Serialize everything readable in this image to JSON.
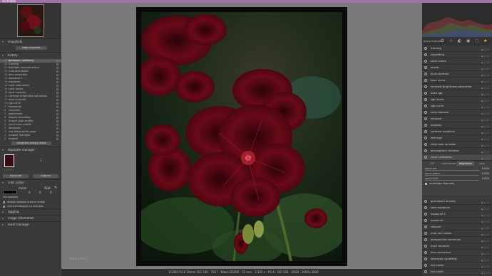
{
  "window": {
    "title": "darktable"
  },
  "left": {
    "snapshots": {
      "title": "snapshots",
      "button": "take snapshot"
    },
    "history": {
      "title": "history",
      "items": [
        {
          "n": "22",
          "label": "demosaic (uniform)"
        },
        {
          "n": "21",
          "label": "framing"
        },
        {
          "n": "20",
          "label": "highlight reconstruction"
        },
        {
          "n": "19",
          "label": "crop and rotate"
        },
        {
          "n": "18",
          "label": "lens correction"
        },
        {
          "n": "17",
          "label": "exposure 1"
        },
        {
          "n": "16",
          "label": "exposure"
        },
        {
          "n": "15",
          "label": "color calibration"
        },
        {
          "n": "14",
          "label": "color zones"
        },
        {
          "n": "13",
          "label": "local contrast"
        },
        {
          "n": "12",
          "label": "contrast brightness saturation"
        },
        {
          "n": "11",
          "label": "local contrast"
        },
        {
          "n": "10",
          "label": "rgb curve"
        },
        {
          "n": "9",
          "label": "toneequal"
        },
        {
          "n": "8",
          "label": "channels"
        },
        {
          "n": "7",
          "label": "watermark"
        },
        {
          "n": "6",
          "label": "display encoding"
        },
        {
          "n": "5",
          "label": "output color profile"
        },
        {
          "n": "4",
          "label": "input color profile"
        },
        {
          "n": "3",
          "label": "demosaic"
        },
        {
          "n": "2",
          "label": "raw black/white point"
        },
        {
          "n": "1",
          "label": "module manager"
        },
        {
          "n": "0",
          "label": "original"
        }
      ],
      "button": "compress history stack"
    },
    "duplicate": {
      "title": "duplicate manager",
      "count": "1",
      "btn_original": "duplicate",
      "btn_virgin": "original"
    },
    "colorpicker": {
      "title": "color picker",
      "mode_label": "mean",
      "model_label": "RGB",
      "values": [
        "0",
        "0",
        "0"
      ],
      "live": "live samples",
      "check1": "display samples area on image",
      "check2": "restrict histogram to selection"
    },
    "tagging": {
      "title": "tagging"
    },
    "image_info": {
      "title": "image information"
    },
    "mask_manager": {
      "title": "mask manager"
    }
  },
  "center": {
    "watermark_text": "with pixel!"
  },
  "statusbar": {
    "text": "1/1000 f/2.8 50mm ISO 100 · 7017 · Nikon D3200 · 55 mm · 1/125 s · f/5.6 · ISO 100 · sRGB · 2000×3000"
  },
  "right": {
    "tabs": [
      "group modules"
    ],
    "modules_top": [
      {
        "label": "framing"
      },
      {
        "label": "vignetting"
      },
      {
        "label": "color zones"
      },
      {
        "label": "velvia"
      },
      {
        "label": "local contrast"
      },
      {
        "label": "tone curve"
      },
      {
        "label": "contrast brightness saturation"
      },
      {
        "label": "base rgb"
      },
      {
        "label": "rgb levels"
      },
      {
        "label": "rgb curve"
      },
      {
        "label": "color balance"
      },
      {
        "label": "sharpen"
      },
      {
        "label": "lowpass"
      },
      {
        "label": "contrast equalizer"
      },
      {
        "label": "defringe"
      },
      {
        "label": "color look up table"
      },
      {
        "label": "atmospheric denoise"
      },
      {
        "label": "color calibration"
      }
    ],
    "cal_tabs": [
      "CAT",
      "colorfulness",
      "brightness",
      "gray"
    ],
    "sliders": [
      {
        "label": "input red",
        "value": "0.000"
      },
      {
        "label": "input green",
        "value": "0.000"
      },
      {
        "label": "input blue",
        "value": "0.000"
      }
    ],
    "normalize": "normalize channels",
    "modules_bottom": [
      {
        "label": "graduated density"
      },
      {
        "label": "tone equalizer"
      },
      {
        "label": "exposure 1"
      },
      {
        "label": "exposure"
      },
      {
        "label": "retouch"
      },
      {
        "label": "crop and rotate"
      },
      {
        "label": "perspective correction"
      },
      {
        "label": "haze removal"
      },
      {
        "label": "lens correction"
      },
      {
        "label": "demosaic (profiled)"
      },
      {
        "label": "hot pixels"
      },
      {
        "label": "hot pixels"
      },
      {
        "label": "module order"
      }
    ]
  }
}
